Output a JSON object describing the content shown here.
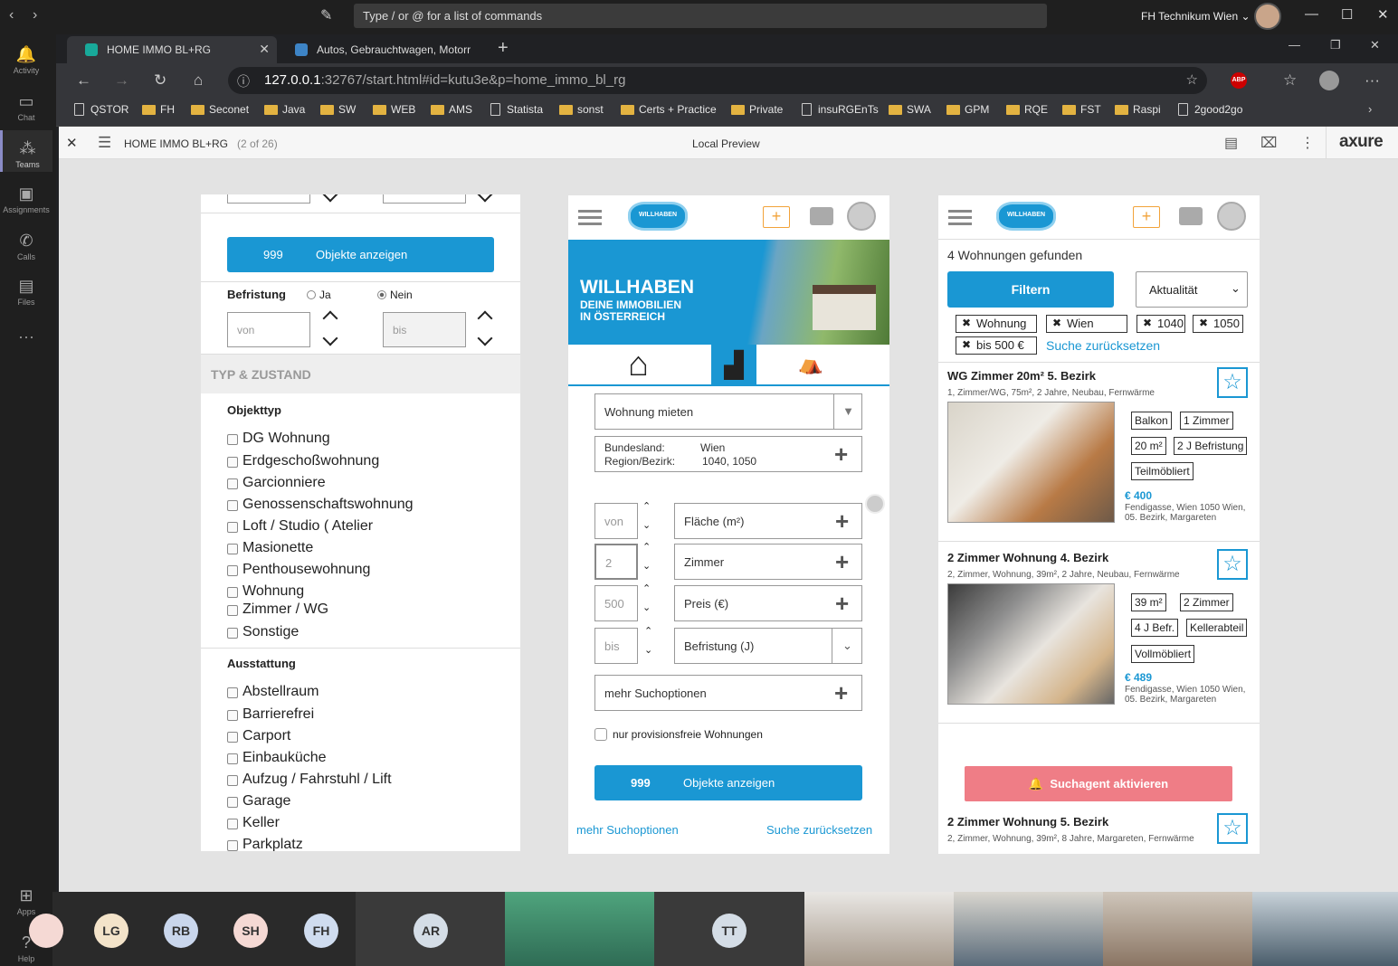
{
  "teams": {
    "command_placeholder": "Type / or @ for a list of commands",
    "org": "FH Technikum Wien ⌄",
    "rail": [
      {
        "label": "Activity",
        "icon": "bell-icon"
      },
      {
        "label": "Chat",
        "icon": "chat-icon"
      },
      {
        "label": "Teams",
        "icon": "teams-icon"
      },
      {
        "label": "Assignments",
        "icon": "assignments-icon"
      },
      {
        "label": "Calls",
        "icon": "phone-icon"
      },
      {
        "label": "Files",
        "icon": "files-icon"
      },
      {
        "label": "Apps",
        "icon": "apps-icon"
      },
      {
        "label": "Help",
        "icon": "help-icon"
      }
    ]
  },
  "browser": {
    "tabs": [
      {
        "title": "HOME IMMO BL+RG",
        "active": true
      },
      {
        "title": "Autos, Gebrauchtwagen, Motorr",
        "active": false
      }
    ],
    "url_host": "127.0.0.1",
    "url_rest": ":32767/start.html#id=kutu3e&p=home_immo_bl_rg",
    "bookmarks": [
      "QSTOR",
      "FH",
      "Seconet",
      "Java",
      "SW",
      "WEB",
      "AMS",
      "Statista",
      "sonst",
      "Certs + Practice",
      "Private",
      "insuRGEnTs",
      "SWA",
      "GPM",
      "RQE",
      "FST",
      "Raspi",
      "2good2go"
    ]
  },
  "axure": {
    "page_name": "HOME IMMO BL+RG",
    "page_count": "(2 of 26)",
    "mode": "Local Preview",
    "brand": "axure"
  },
  "panel1": {
    "count": "999",
    "show_label": "Objekte anzeigen",
    "befristung_label": "Befristung",
    "ja": "Ja",
    "nein": "Nein",
    "von": "von",
    "bis": "bis",
    "section": "TYP & ZUSTAND",
    "objekttyp_heading": "Objekttyp",
    "objekttyp": [
      "DG Wohnung",
      "Erdgeschoßwohnung",
      "Garcionniere",
      "Genossenschaftswohnung",
      "Loft / Studio ( Atelier",
      "Masionette",
      "Penthousewohnung",
      "Wohnung",
      "Zimmer / WG",
      "Sonstige"
    ],
    "ausstattung_heading": "Ausstattung",
    "ausstattung": [
      "Abstellraum",
      "Barrierefrei",
      "Carport",
      "Einbauküche",
      "Aufzug / Fahrstuhl / Lift",
      "Garage",
      "Keller",
      "Parkplatz"
    ]
  },
  "panel2": {
    "logo": "WILLHABEN",
    "banner_title": "WILLHABEN",
    "banner_sub1": "DEINE IMMOBILIEN",
    "banner_sub2": "IN ÖSTERREICH",
    "category": "Wohnung mieten",
    "bundesland_label": "Bundesland:",
    "bundesland_value": "Wien",
    "region_label": "Region/Bezirk:",
    "region_value": "1040, 1050",
    "rows": [
      {
        "input": "von",
        "field": "Fläche (m²)"
      },
      {
        "input": "2",
        "field": "Zimmer"
      },
      {
        "input": "500",
        "field": "Preis (€)"
      },
      {
        "input": "bis",
        "field": "Befristung (J)"
      }
    ],
    "more_options": "mehr Suchoptionen",
    "provisionsfrei": "nur provisionsfreie Wohnungen",
    "count": "999",
    "show_label": "Objekte anzeigen",
    "link_more": "mehr Suchoptionen",
    "link_reset": "Suche zurücksetzen"
  },
  "panel3": {
    "logo": "WILLHABEN",
    "found": "4 Wohnungen gefunden",
    "filter": "Filtern",
    "sort": "Aktualität",
    "chips": [
      "Wohnung",
      "Wien",
      "1040",
      "1050",
      "bis 500 €"
    ],
    "reset": "Suche zurücksetzen",
    "listings": [
      {
        "title": "WG Zimmer 20m² 5. Bezirk",
        "sub": "1, Zimmer/WG, 75m², 2 Jahre, Neubau, Fernwärme",
        "tags": [
          "Balkon",
          "1 Zimmer",
          "20 m²",
          "2 J Befristung",
          "Teilmöbliert"
        ],
        "price": "€ 400",
        "addr": "Fendigasse, Wien 1050 Wien, 05. Bezirk, Margareten"
      },
      {
        "title": "2 Zimmer Wohnung 4. Bezirk",
        "sub": "2, Zimmer, Wohnung, 39m², 2 Jahre, Neubau, Fernwärme",
        "tags": [
          "39 m²",
          "2 Zimmer",
          "4 J Befr.",
          "Kellerabteil",
          "Vollmöbliert"
        ],
        "price": "€ 489",
        "addr": "Fendigasse, Wien 1050 Wien, 05. Bezirk, Margareten"
      },
      {
        "title": "2 Zimmer Wohnung 5. Bezirk",
        "sub": "2, Zimmer, Wohnung, 39m², 8 Jahre, Margareten, Fernwärme"
      }
    ],
    "agent": "Suchagent aktivieren"
  },
  "participants": [
    {
      "initials": "LG",
      "color": "#f3e3c9"
    },
    {
      "initials": "RB",
      "color": "#c9d6ec"
    },
    {
      "initials": "SH",
      "color": "#f5d9d4"
    },
    {
      "initials": "FH",
      "color": "#cfdcef"
    },
    {
      "initials": "AR",
      "color": "#d4dde6"
    },
    {
      "initials": "TT",
      "color": "#d4dde6"
    }
  ],
  "colors": {
    "accent": "#1a97d3",
    "agent": "#ef7d86",
    "teams_rail": "#8b8cc7"
  }
}
